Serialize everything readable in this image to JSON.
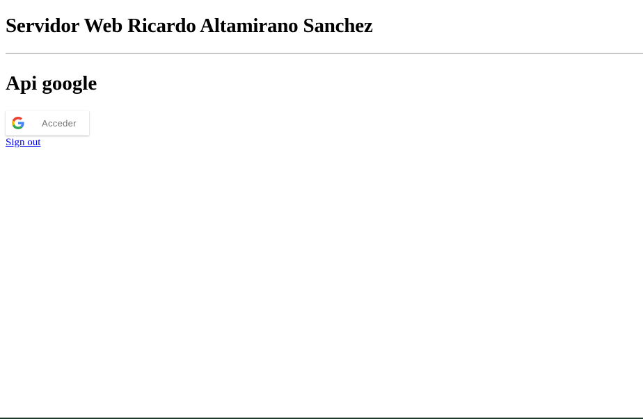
{
  "page": {
    "title": "Servidor Web Ricardo Altamirano Sanchez",
    "section_title": "Api google"
  },
  "google_signin": {
    "label": "Acceder",
    "icon": "google-g-icon"
  },
  "sign_out": {
    "label": "Sign out"
  },
  "colors": {
    "link": "#0000ee",
    "button_label": "#757575",
    "google_blue": "#4285F4",
    "google_red": "#EA4335",
    "google_yellow": "#FBBC05",
    "google_green": "#34A853"
  }
}
